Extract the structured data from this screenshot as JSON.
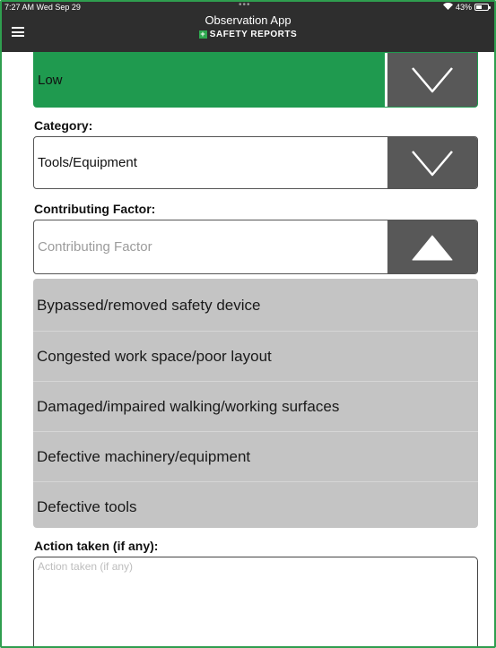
{
  "status": {
    "time_date": "7:27 AM  Wed Sep 29",
    "dots": "•••",
    "wifi": "▲",
    "battery": "43%"
  },
  "header": {
    "title": "Observation App",
    "subtitle": "SAFETY REPORTS",
    "plus": "+"
  },
  "risk_select": {
    "value": "Low",
    "color": "#1f9a4f"
  },
  "category": {
    "label": "Category:",
    "value": "Tools/Equipment"
  },
  "contributing_factor": {
    "label": "Contributing Factor:",
    "placeholder": "Contributing Factor",
    "options": [
      "Bypassed/removed safety device",
      "Congested work space/poor layout",
      "Damaged/impaired walking/working surfaces",
      "Defective machinery/equipment",
      "Defective tools"
    ]
  },
  "action_taken": {
    "label": "Action taken (if any):",
    "placeholder": "Action taken (if any)"
  },
  "colors": {
    "header": "#2e2e2e",
    "accent_green": "#1f9a4f",
    "arrow_box": "#585858",
    "dropdown_bg": "#c4c4c4"
  }
}
